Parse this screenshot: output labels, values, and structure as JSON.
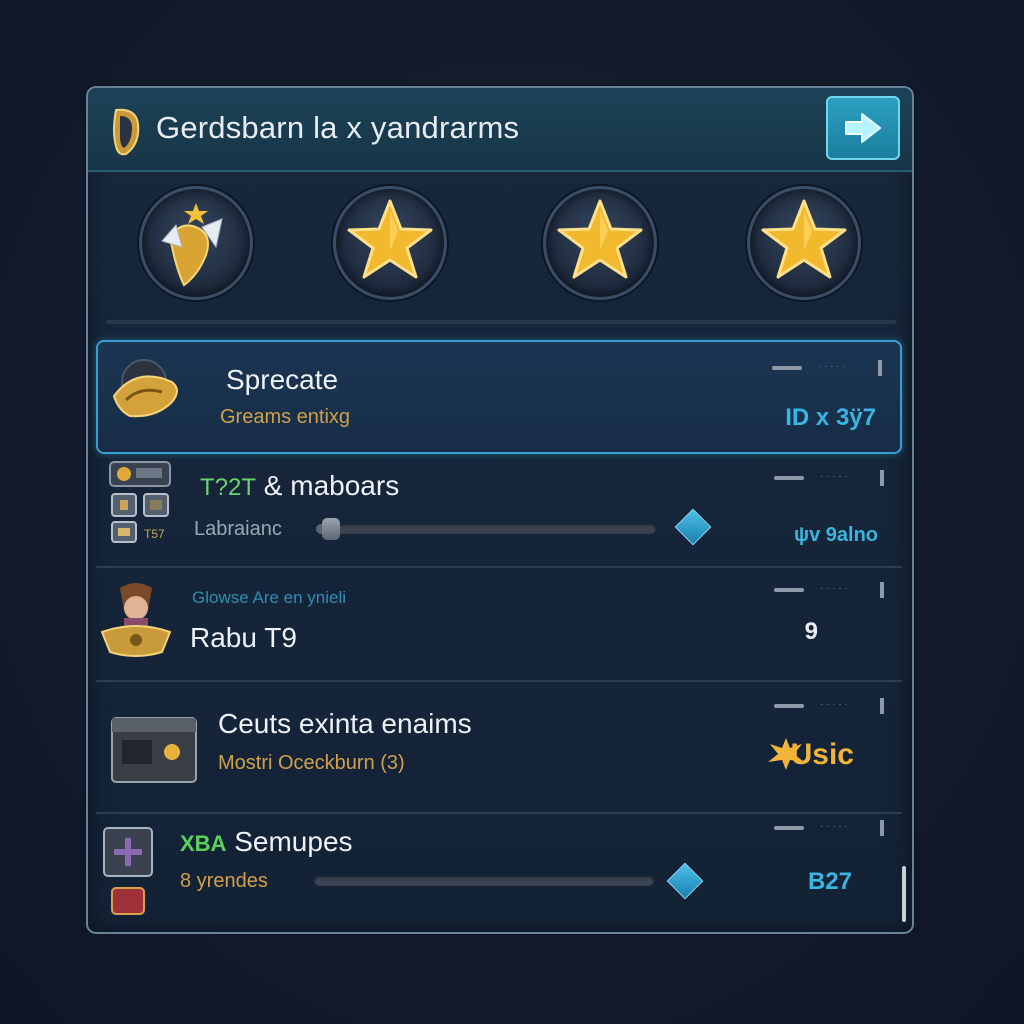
{
  "header": {
    "title": "Gerdsbarn la x yandrarms",
    "icon": "horn-icon",
    "next_icon": "arrow-right-icon"
  },
  "medals": [
    {
      "name": "winged-medal-icon"
    },
    {
      "name": "star-medal-icon"
    },
    {
      "name": "star-medal-icon"
    },
    {
      "name": "star-medal-icon"
    }
  ],
  "rows": [
    {
      "title": "Sprecate",
      "subtitle": "Greams entixg",
      "value": "ID x 3ÿ7",
      "icon": "golden-horn-icon"
    },
    {
      "title": "& maboars",
      "prefix": "T?2T",
      "label": "Labraianc",
      "value": "ψv 9alno",
      "slider": 0.04,
      "icon": "item-grid-icon"
    },
    {
      "title": "Rabu T9",
      "subtitle": "Glowse Are en ynieli",
      "value": "9",
      "icon": "character-portrait-icon"
    },
    {
      "title": "Ceuts exinta enaims",
      "subtitle": "Mostri Oceckburn (3)",
      "value": "Usic",
      "icon": "treasure-chest-icon"
    },
    {
      "title": "Semupes",
      "prefix": "XBA",
      "label": "8 yrendes",
      "value": "B27",
      "slider": 0.0,
      "icon": "plus-box-icon"
    }
  ],
  "colors": {
    "accent": "#3ab4e0",
    "gold": "#f0b43a",
    "panel": "#17283c"
  }
}
